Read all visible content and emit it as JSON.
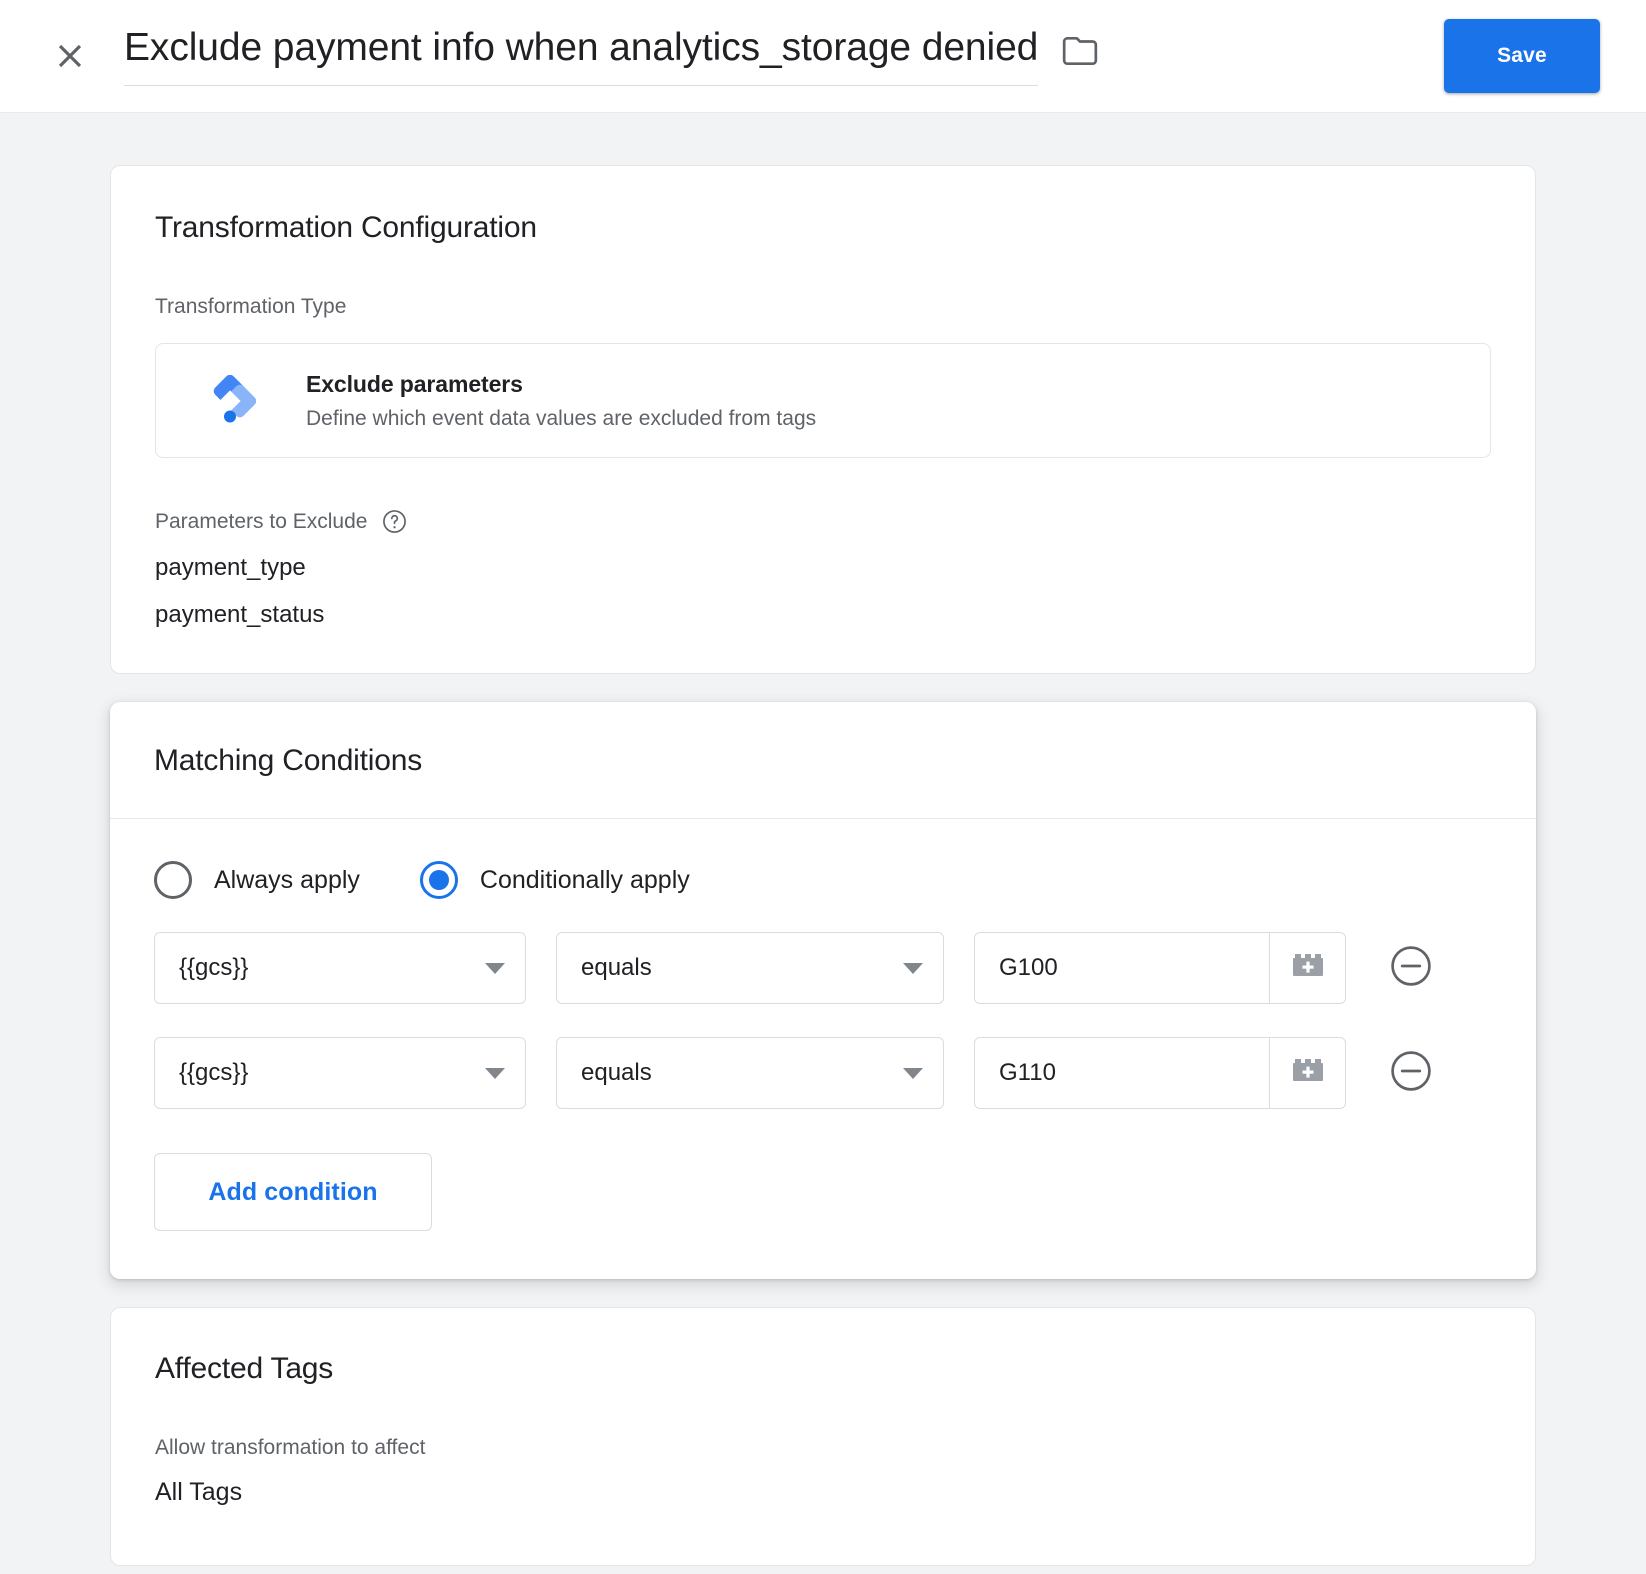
{
  "header": {
    "close_icon": "close-icon",
    "title": "Exclude payment info when analytics_storage denied",
    "folder_icon": "folder-icon",
    "save_label": "Save",
    "accent_color": "#1a73e8"
  },
  "transformation_card": {
    "title": "Transformation Configuration",
    "type_label": "Transformation Type",
    "selected_type": {
      "icon": "gtm-diamond-icon",
      "name": "Exclude parameters",
      "description": "Define which event data values are excluded from tags"
    },
    "parameters_label": "Parameters to Exclude",
    "help_icon": "help-circle-icon",
    "parameters": [
      "payment_type",
      "payment_status"
    ]
  },
  "matching_conditions_card": {
    "title": "Matching Conditions",
    "apply_mode": {
      "selected": "conditionally",
      "options": [
        {
          "id": "always",
          "label": "Always apply",
          "checked": false
        },
        {
          "id": "conditionally",
          "label": "Conditionally apply",
          "checked": true
        }
      ]
    },
    "conditions": [
      {
        "variable": "{{gcs}}",
        "operator": "equals",
        "value": "G100",
        "value_placeholder": "",
        "insert_variable_icon": "lego-brick-plus-icon",
        "remove_icon": "minus-circle-icon"
      },
      {
        "variable": "{{gcs}}",
        "operator": "equals",
        "value": "G110",
        "value_placeholder": "",
        "insert_variable_icon": "lego-brick-plus-icon",
        "remove_icon": "minus-circle-icon"
      }
    ],
    "add_condition_label": "Add condition"
  },
  "affected_tags_card": {
    "title": "Affected Tags",
    "sublabel": "Allow transformation to affect",
    "value": "All Tags"
  }
}
